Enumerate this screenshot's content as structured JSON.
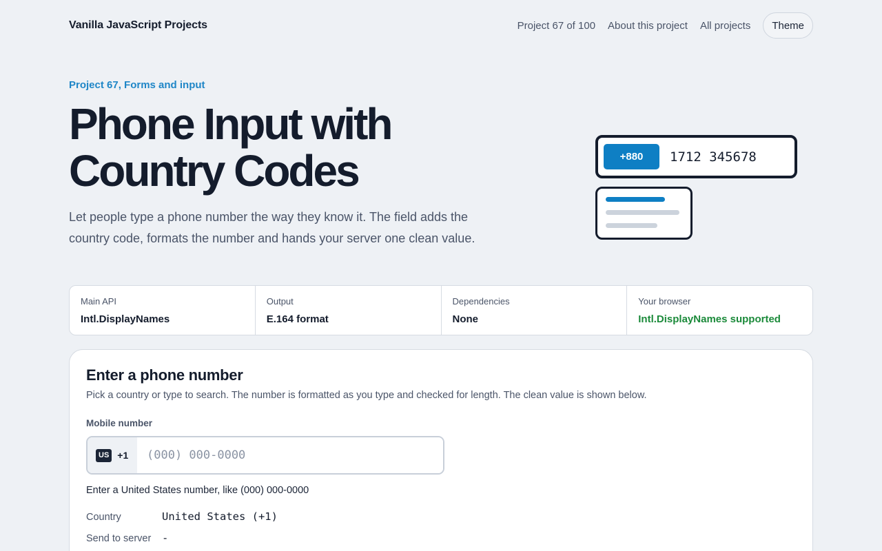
{
  "header": {
    "brand": "Vanilla JavaScript Projects",
    "nav": {
      "counter": "Project 67 of 100",
      "about": "About this project",
      "all": "All projects",
      "theme": "Theme"
    }
  },
  "hero": {
    "eyebrow": "Project 67, Forms and input",
    "title_line1": "Phone Input with",
    "title_line2": "Country Codes",
    "lede": "Let people type a phone number the way they know it. The field adds the country code, formats the number and hands your server one clean value."
  },
  "illustration": {
    "code": "+880",
    "number": "1712 345678"
  },
  "stats": [
    {
      "label": "Main API",
      "value": "Intl.DisplayNames"
    },
    {
      "label": "Output",
      "value": "E.164 format"
    },
    {
      "label": "Dependencies",
      "value": "None"
    },
    {
      "label": "Your browser",
      "value": "Intl.DisplayNames supported"
    }
  ],
  "form": {
    "title": "Enter a phone number",
    "description": "Pick a country or type to search. The number is formatted as you type and checked for length. The clean value is shown below.",
    "field_label": "Mobile number",
    "country_badge": "US",
    "dial_code": "+1",
    "input_value": "",
    "placeholder": "(000) 000-0000",
    "hint": "Enter a United States number, like (000) 000-0000",
    "country_key": "Country",
    "country_value": "United States (+1)",
    "send_key": "Send to server",
    "send_value": "-"
  },
  "colors": {
    "accent": "#0e7fc4",
    "success": "#1b8a3a",
    "background": "#eef1f5"
  }
}
